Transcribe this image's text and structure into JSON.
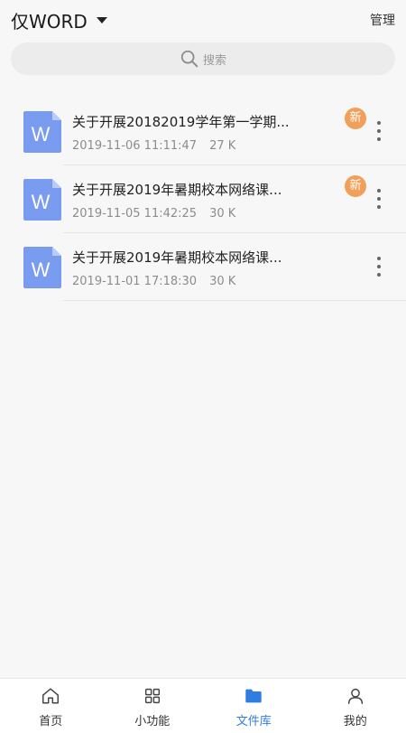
{
  "header": {
    "title": "仅WORD",
    "manage_label": "管理"
  },
  "search": {
    "placeholder": "搜索"
  },
  "files": [
    {
      "name": "关于开展20182019学年第一学期...",
      "date": "2019-11-06 11:11:47",
      "size": "27 K",
      "badge": "新"
    },
    {
      "name": "关于开展2019年暑期校本网络课...",
      "date": "2019-11-05 11:42:25",
      "size": "30 K",
      "badge": "新"
    },
    {
      "name": "关于开展2019年暑期校本网络课...",
      "date": "2019-11-01 17:18:30",
      "size": "30 K"
    }
  ],
  "tabs": [
    {
      "label": "首页",
      "icon": "home-icon"
    },
    {
      "label": "小功能",
      "icon": "grid-icon"
    },
    {
      "label": "文件库",
      "icon": "folder-icon",
      "active": true
    },
    {
      "label": "我的",
      "icon": "user-icon"
    }
  ],
  "colors": {
    "accent": "#2f7de1",
    "badge": "#f0a05a",
    "word_icon": "#7a9cf0"
  }
}
